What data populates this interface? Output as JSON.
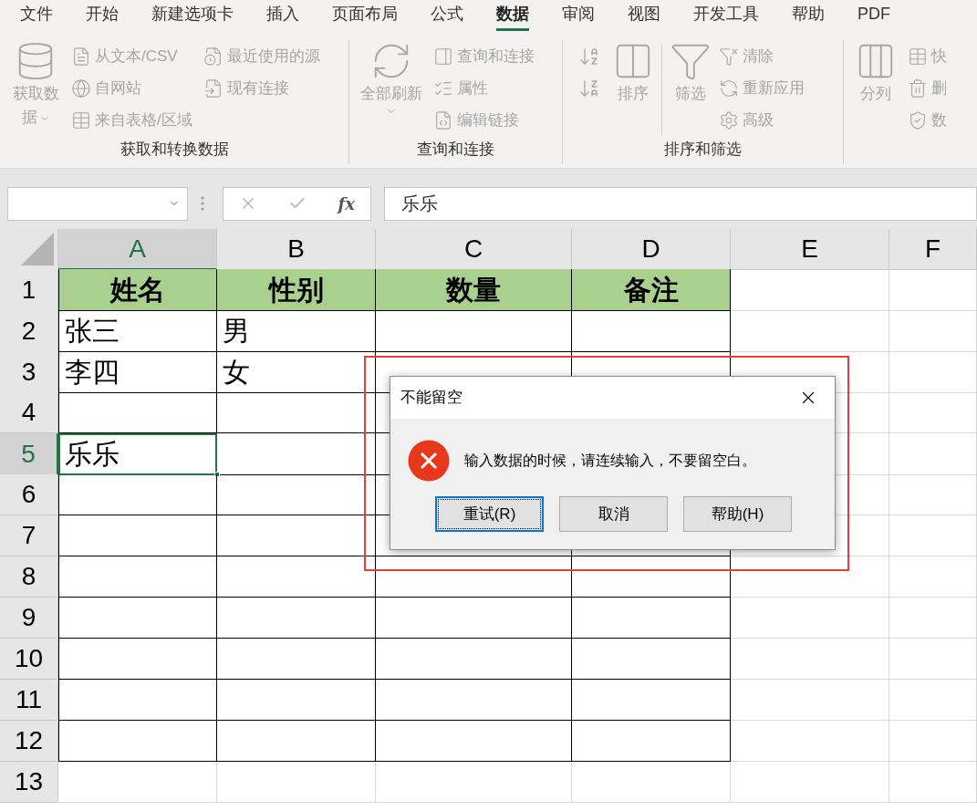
{
  "tabs": [
    {
      "label": "文件",
      "selected": false
    },
    {
      "label": "开始",
      "selected": false
    },
    {
      "label": "新建选项卡",
      "selected": false
    },
    {
      "label": "插入",
      "selected": false
    },
    {
      "label": "页面布局",
      "selected": false
    },
    {
      "label": "公式",
      "selected": false
    },
    {
      "label": "数据",
      "selected": true
    },
    {
      "label": "审阅",
      "selected": false
    },
    {
      "label": "视图",
      "selected": false
    },
    {
      "label": "开发工具",
      "selected": false
    },
    {
      "label": "帮助",
      "selected": false
    },
    {
      "label": "PDF",
      "selected": false
    }
  ],
  "ribbon": {
    "groups": [
      {
        "label": "获取和转换数据",
        "columns": [
          [
            {
              "kind": "large",
              "label": "获取数据",
              "disabled": true,
              "dropdown": true
            }
          ],
          [
            {
              "kind": "small",
              "label": "从文本/CSV",
              "disabled": true
            },
            {
              "kind": "small",
              "label": "自网站",
              "disabled": true
            },
            {
              "kind": "small",
              "label": "来自表格/区域",
              "disabled": true
            }
          ],
          [
            {
              "kind": "small",
              "label": "最近使用的源",
              "disabled": true
            },
            {
              "kind": "small",
              "label": "现有连接",
              "disabled": true
            }
          ]
        ]
      },
      {
        "label": "查询和连接",
        "columns": [
          [
            {
              "kind": "large",
              "label": "全部刷新",
              "disabled": true,
              "dropdown": true
            }
          ],
          [
            {
              "kind": "small",
              "label": "查询和连接",
              "disabled": true
            },
            {
              "kind": "small",
              "label": "属性",
              "disabled": true
            },
            {
              "kind": "small",
              "label": "编辑链接",
              "disabled": true
            }
          ]
        ]
      },
      {
        "label": "排序和筛选",
        "columns": [
          [
            {
              "kind": "icon",
              "disabled": true
            },
            {
              "kind": "icon",
              "disabled": true
            }
          ],
          [
            {
              "kind": "large",
              "label": "排序",
              "disabled": true,
              "dropdown": false
            }
          ],
          [
            {
              "kind": "separator"
            }
          ],
          [
            {
              "kind": "large",
              "label": "筛选",
              "disabled": true,
              "dropdown": false
            }
          ],
          [
            {
              "kind": "small",
              "label": "清除",
              "disabled": true
            },
            {
              "kind": "small",
              "label": "重新应用",
              "disabled": true
            },
            {
              "kind": "small",
              "label": "高级",
              "disabled": true
            }
          ]
        ]
      },
      {
        "columns": [
          [
            {
              "kind": "large",
              "label": "分列",
              "disabled": true,
              "dropdown": false
            }
          ],
          [
            {
              "kind": "small",
              "label": "快",
              "disabled": true
            },
            {
              "kind": "small",
              "label": "删",
              "disabled": true
            },
            {
              "kind": "small",
              "label": "数",
              "disabled": true
            }
          ]
        ]
      }
    ]
  },
  "formula_bar": {
    "function_label": "fx",
    "value": "乐乐"
  },
  "sheet": {
    "columns": [
      {
        "label": "A",
        "selected": true
      },
      {
        "label": "B",
        "selected": false
      },
      {
        "label": "C",
        "selected": false
      },
      {
        "label": "D",
        "selected": false
      },
      {
        "label": "E",
        "selected": false
      },
      {
        "label": "F",
        "selected": false
      }
    ],
    "rows": [
      {
        "number": "1",
        "kind": "header",
        "selected": false,
        "cells": {
          "A": "姓名",
          "B": "性别",
          "C": "数量",
          "D": "备注"
        }
      },
      {
        "number": "2",
        "kind": "data",
        "selected": false,
        "cells": {
          "A": "张三",
          "B": "男"
        }
      },
      {
        "number": "3",
        "kind": "data",
        "selected": false,
        "cells": {
          "A": "李四",
          "B": "女"
        }
      },
      {
        "number": "4",
        "kind": "data",
        "selected": false,
        "cells": {}
      },
      {
        "number": "5",
        "kind": "data",
        "selected": true,
        "cells": {
          "A": "乐乐"
        }
      },
      {
        "number": "6",
        "kind": "data",
        "selected": false,
        "cells": {}
      },
      {
        "number": "7",
        "kind": "data",
        "selected": false,
        "cells": {}
      },
      {
        "number": "8",
        "kind": "data",
        "selected": false,
        "cells": {}
      },
      {
        "number": "9",
        "kind": "data",
        "selected": false,
        "cells": {}
      },
      {
        "number": "10",
        "kind": "data",
        "selected": false,
        "cells": {}
      },
      {
        "number": "11",
        "kind": "data",
        "selected": false,
        "cells": {}
      },
      {
        "number": "12",
        "kind": "data",
        "selected": false,
        "cells": {}
      },
      {
        "number": "13",
        "kind": "blank",
        "selected": false,
        "cells": {}
      }
    ]
  },
  "dialog": {
    "title": "不能留空",
    "message": "输入数据的时候，请连续输入，不要留空白。",
    "buttons": [
      {
        "label": "重试(R)",
        "focused": true
      },
      {
        "label": "取消",
        "focused": false
      },
      {
        "label": "帮助(H)",
        "focused": false
      }
    ]
  }
}
